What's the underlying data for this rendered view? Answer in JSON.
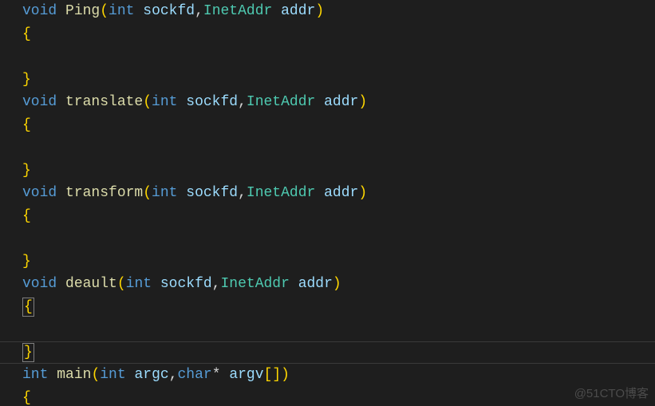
{
  "code": {
    "lines": [
      {
        "tokens": [
          {
            "t": "void ",
            "c": "tok-kw"
          },
          {
            "t": "Ping",
            "c": "tok-fn"
          },
          {
            "t": "(",
            "c": "tok-br"
          },
          {
            "t": "int ",
            "c": "tok-kw"
          },
          {
            "t": "sockfd",
            "c": "tok-var"
          },
          {
            "t": ",",
            "c": "tok-pn"
          },
          {
            "t": "InetAddr ",
            "c": "tok-type"
          },
          {
            "t": "addr",
            "c": "tok-var"
          },
          {
            "t": ")",
            "c": "tok-br"
          }
        ]
      },
      {
        "tokens": [
          {
            "t": "{",
            "c": "tok-br"
          }
        ]
      },
      {
        "tokens": []
      },
      {
        "tokens": [
          {
            "t": "}",
            "c": "tok-br"
          }
        ]
      },
      {
        "tokens": [
          {
            "t": "void ",
            "c": "tok-kw"
          },
          {
            "t": "translate",
            "c": "tok-fn"
          },
          {
            "t": "(",
            "c": "tok-br"
          },
          {
            "t": "int ",
            "c": "tok-kw"
          },
          {
            "t": "sockfd",
            "c": "tok-var"
          },
          {
            "t": ",",
            "c": "tok-pn"
          },
          {
            "t": "InetAddr ",
            "c": "tok-type"
          },
          {
            "t": "addr",
            "c": "tok-var"
          },
          {
            "t": ")",
            "c": "tok-br"
          }
        ]
      },
      {
        "tokens": [
          {
            "t": "{",
            "c": "tok-br"
          }
        ]
      },
      {
        "tokens": []
      },
      {
        "tokens": [
          {
            "t": "}",
            "c": "tok-br"
          }
        ]
      },
      {
        "tokens": [
          {
            "t": "void ",
            "c": "tok-kw"
          },
          {
            "t": "transform",
            "c": "tok-fn"
          },
          {
            "t": "(",
            "c": "tok-br"
          },
          {
            "t": "int ",
            "c": "tok-kw"
          },
          {
            "t": "sockfd",
            "c": "tok-var"
          },
          {
            "t": ",",
            "c": "tok-pn"
          },
          {
            "t": "InetAddr ",
            "c": "tok-type"
          },
          {
            "t": "addr",
            "c": "tok-var"
          },
          {
            "t": ")",
            "c": "tok-br"
          }
        ]
      },
      {
        "tokens": [
          {
            "t": "{",
            "c": "tok-br"
          }
        ]
      },
      {
        "tokens": []
      },
      {
        "tokens": [
          {
            "t": "}",
            "c": "tok-br"
          }
        ]
      },
      {
        "tokens": [
          {
            "t": "void ",
            "c": "tok-kw"
          },
          {
            "t": "deault",
            "c": "tok-fn"
          },
          {
            "t": "(",
            "c": "tok-br"
          },
          {
            "t": "int ",
            "c": "tok-kw"
          },
          {
            "t": "sockfd",
            "c": "tok-var"
          },
          {
            "t": ",",
            "c": "tok-pn"
          },
          {
            "t": "InetAddr ",
            "c": "tok-type"
          },
          {
            "t": "addr",
            "c": "tok-var"
          },
          {
            "t": ")",
            "c": "tok-br"
          }
        ]
      },
      {
        "tokens": [
          {
            "t": "{",
            "c": "tok-br",
            "boxed": true
          }
        ]
      },
      {
        "tokens": []
      },
      {
        "tokens": [
          {
            "t": "}",
            "c": "tok-br",
            "boxed": true
          }
        ],
        "active": true
      },
      {
        "tokens": [
          {
            "t": "int ",
            "c": "tok-kw"
          },
          {
            "t": "main",
            "c": "tok-fn"
          },
          {
            "t": "(",
            "c": "tok-br"
          },
          {
            "t": "int ",
            "c": "tok-kw"
          },
          {
            "t": "argc",
            "c": "tok-var"
          },
          {
            "t": ",",
            "c": "tok-pn"
          },
          {
            "t": "char",
            "c": "tok-kw"
          },
          {
            "t": "* ",
            "c": "tok-pn"
          },
          {
            "t": "argv",
            "c": "tok-var"
          },
          {
            "t": "[]",
            "c": "tok-br"
          },
          {
            "t": ")",
            "c": "tok-br"
          }
        ]
      },
      {
        "tokens": [
          {
            "t": "{",
            "c": "tok-br"
          }
        ]
      }
    ]
  },
  "watermark": "@51CTO博客",
  "theme": {
    "background": "#1e1e1e",
    "keyword": "#569cd6",
    "function": "#dcdcaa",
    "type": "#4ec9b0",
    "variable": "#9cdcfe",
    "bracket": "#ffd700",
    "text": "#d4d4d4"
  }
}
